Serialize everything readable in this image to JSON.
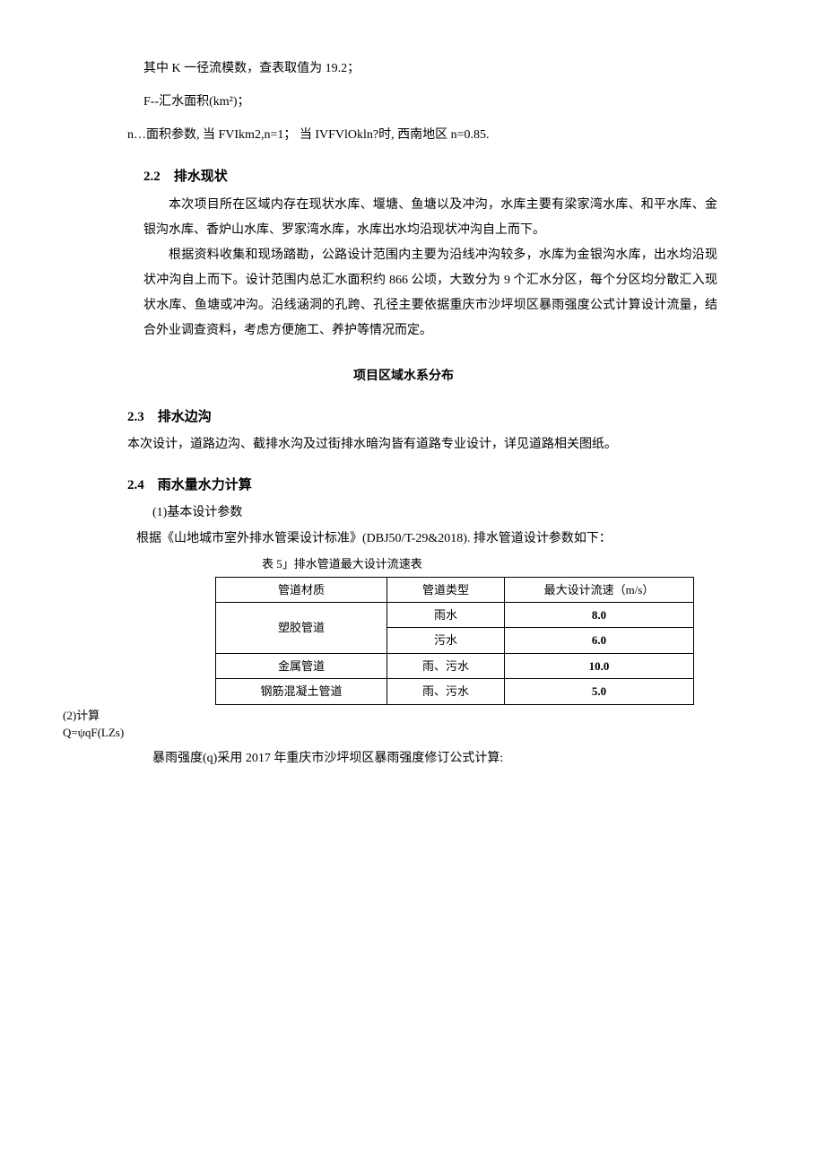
{
  "pre": {
    "line1": "其中 K 一径流模数，查表取值为 19.2；",
    "line2": "F--汇水面积(km²)；",
    "line3": "n…面积参数, 当 FVIkm2,n=1； 当 IVFVlOkln?时, 西南地区 n=0.85."
  },
  "sec22": {
    "heading": "2.2　排水现状",
    "p1": "本次项目所在区域内存在现状水库、堰塘、鱼塘以及冲沟，水库主要有梁家湾水库、和平水库、金银沟水库、香炉山水库、罗家湾水库，水库出水均沿现状冲沟自上而下。",
    "p2": "根据资料收集和现场踏勘，公路设计范围内主要为沿线冲沟较多，水库为金银沟水库，出水均沿现状冲沟自上而下。设计范围内总汇水面积约 866 公顷，大致分为 9 个汇水分区，每个分区均分散汇入现状水库、鱼塘或冲沟。沿线涵洞的孔跨、孔径主要依据重庆市沙坪坝区暴雨强度公式计算设计流量，结合外业调查资料，考虑方便施工、养护等情况而定。"
  },
  "midTitle": "项目区域水系分布",
  "sec23": {
    "heading": "2.3　排水边沟",
    "p1": "本次设计，道路边沟、截排水沟及过街排水暗沟皆有道路专业设计，详见道路相关图纸。"
  },
  "sec24": {
    "heading": "2.4　雨水量水力计算",
    "sub1": "(1)基本设计参数",
    "p1": "根据《山地城市室外排水管渠设计标准》(DBJ50/T-29&2018). 排水管道设计参数如下：",
    "tableCaption": "表 5」排水管道最大设计流速表",
    "sub2a": "(2)计算",
    "sub2b": "Q=ψqF(LZs)",
    "p2": "暴雨强度(q)采用 2017 年重庆市沙坪坝区暴雨强度修订公式计算:"
  },
  "table": {
    "headers": [
      "管道材质",
      "管道类型",
      "最大设计流速（m/s）"
    ],
    "rows": [
      {
        "material": "塑胶管道",
        "type1": "雨水",
        "val1": "8.0",
        "type2": "污水",
        "val2": "6.0",
        "rowspan": 2
      },
      {
        "material": "金属管道",
        "type": "雨、污水",
        "val": "10.0"
      },
      {
        "material": "钢筋混凝土管道",
        "type": "雨、污水",
        "val": "5.0"
      }
    ]
  }
}
